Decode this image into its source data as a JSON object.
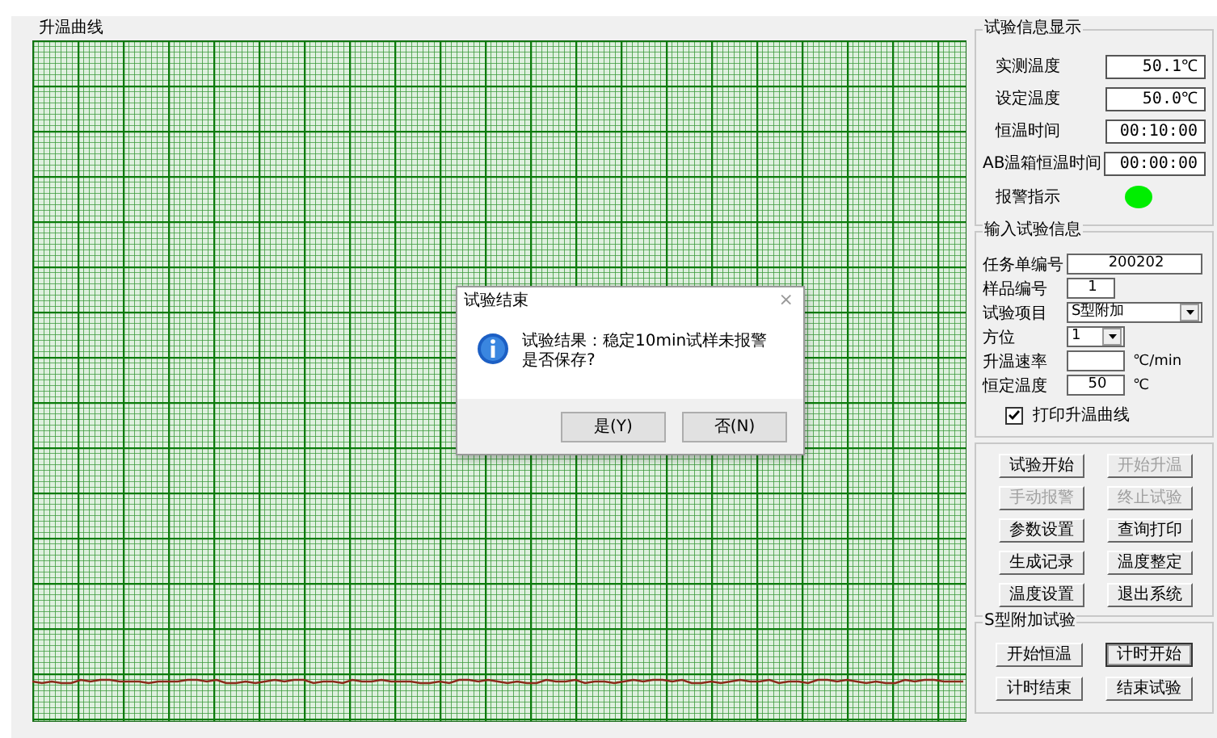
{
  "chart_panel": {
    "title": "升温曲线"
  },
  "dialog": {
    "title": "试验结束",
    "close": "×",
    "message": "试验结果：稳定10min试样未报警",
    "question": "是否保存?",
    "buttons": [
      "是(Y)",
      "否(N)"
    ]
  },
  "info_display": {
    "title": "试验信息显示",
    "rows": [
      {
        "label": "实测温度",
        "value": "50.1℃"
      },
      {
        "label": "设定温度",
        "value": "50.0℃"
      },
      {
        "label": "恒温时间",
        "value": "00:10:00"
      },
      {
        "label": "AB温箱恒温时间",
        "value": "00:00:00"
      }
    ],
    "alarm": {
      "label": "报警指示",
      "color": "#00ee00"
    }
  },
  "input_info": {
    "title": "输入试验信息",
    "rows": [
      {
        "kind": "text",
        "label": "任务单编号",
        "value": "200202"
      },
      {
        "kind": "text",
        "label": "样品编号",
        "value": "1"
      },
      {
        "kind": "select",
        "label": "试验项目",
        "value": "S型附加"
      },
      {
        "kind": "select",
        "label": "方位",
        "value": "1"
      },
      {
        "kind": "text",
        "label": "升温速率",
        "unit": "℃/min"
      },
      {
        "kind": "text",
        "label": "恒定温度",
        "value": "50",
        "unit": "℃"
      }
    ],
    "checkbox": {
      "label": "打印升温曲线",
      "checked": true
    }
  },
  "controls": [
    {
      "label": "试验开始",
      "disabled": false
    },
    {
      "label": "开始升温",
      "disabled": true
    },
    {
      "label": "手动报警",
      "disabled": true
    },
    {
      "label": "终止试验",
      "disabled": true
    },
    {
      "label": "参数设置",
      "disabled": false
    },
    {
      "label": "查询打印",
      "disabled": false
    },
    {
      "label": "生成记录",
      "disabled": false
    },
    {
      "label": "温度整定",
      "disabled": false
    },
    {
      "label": "温度设置",
      "disabled": false
    },
    {
      "label": "退出系统",
      "disabled": false
    }
  ],
  "s_test": {
    "title": "S型附加试验",
    "buttons": [
      {
        "label": "开始恒温",
        "focused": false
      },
      {
        "label": "计时开始",
        "focused": true
      },
      {
        "label": "计时结束",
        "focused": false
      },
      {
        "label": "结束试验",
        "focused": false
      }
    ]
  }
}
